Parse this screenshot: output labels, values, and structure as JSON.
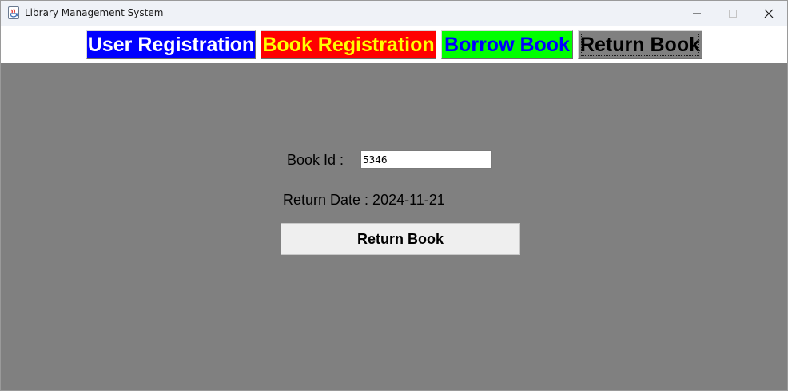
{
  "window": {
    "title": "Library Management System",
    "icon": "java-cup-icon",
    "controls": [
      "minimize-icon",
      "maximize-icon",
      "close-icon"
    ]
  },
  "tabs": [
    {
      "label": "User Registration",
      "background": "#0000ff",
      "color": "#ffffff"
    },
    {
      "label": "Book Registration",
      "background": "#ff0000",
      "color": "#ffff00"
    },
    {
      "label": "Borrow Book",
      "background": "#00ff00",
      "color": "#0000ff"
    },
    {
      "label": "Return Book",
      "background": "#808080",
      "color": "#000000",
      "selected": true
    }
  ],
  "form": {
    "book_id_label": "Book Id :",
    "book_id_value": "5346",
    "return_date_text": "Return Date : 2024-11-21",
    "submit_label": "Return Book"
  },
  "colors": {
    "panel_background": "#808080",
    "tabbar_background": "#ffffff"
  }
}
